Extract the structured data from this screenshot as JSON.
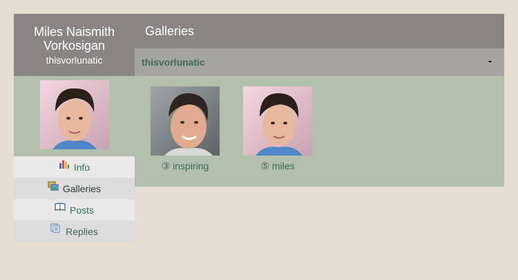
{
  "profile": {
    "name_line1": "Miles Naismith",
    "name_line2": "Vorkosigan",
    "username": "thisvorlunatic"
  },
  "menu": [
    {
      "label": "Info",
      "icon": "chart-icon"
    },
    {
      "label": "Galleries",
      "icon": "galleries-icon"
    },
    {
      "label": "Posts",
      "icon": "book-icon"
    },
    {
      "label": "Replies",
      "icon": "replies-icon"
    }
  ],
  "section": {
    "title": "Galleries"
  },
  "gallery": {
    "title": "thisvorlunatic",
    "collapse_label": "-",
    "thumbs": [
      {
        "caption": "③ inspiring"
      },
      {
        "caption": "⑤ miles"
      }
    ]
  },
  "colors": {
    "page_bg": "#e5dfd2",
    "header_bg": "#8a8585",
    "subheader_bg": "#a6a3a3",
    "panel_bg": "#b3bfad",
    "link_green": "#3e6a55"
  }
}
